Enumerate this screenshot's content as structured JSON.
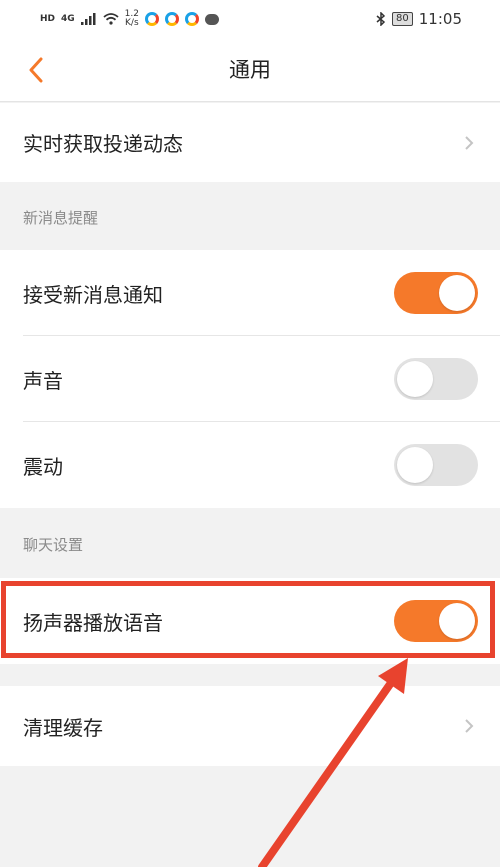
{
  "status_bar": {
    "network_hd": "HD",
    "signal": "4G",
    "speed_value": "1.2",
    "speed_unit": "K/s",
    "battery": "80",
    "time": "11:05"
  },
  "header": {
    "title": "通用",
    "back_icon": "chevron-left-icon"
  },
  "rows": {
    "tracking": "实时获取投递动态"
  },
  "sections": {
    "new_message": "新消息提醒",
    "chat": "聊天设置"
  },
  "toggles": {
    "receive_notifications": {
      "label": "接受新消息通知",
      "on": true
    },
    "sound": {
      "label": "声音",
      "on": false
    },
    "vibration": {
      "label": "震动",
      "on": false
    },
    "speaker_voice": {
      "label": "扬声器播放语音",
      "on": true
    }
  },
  "clear_cache": "清理缓存",
  "colors": {
    "accent": "#f5792a",
    "highlight": "#e8432e",
    "toggle_off": "#e2e2e2"
  }
}
